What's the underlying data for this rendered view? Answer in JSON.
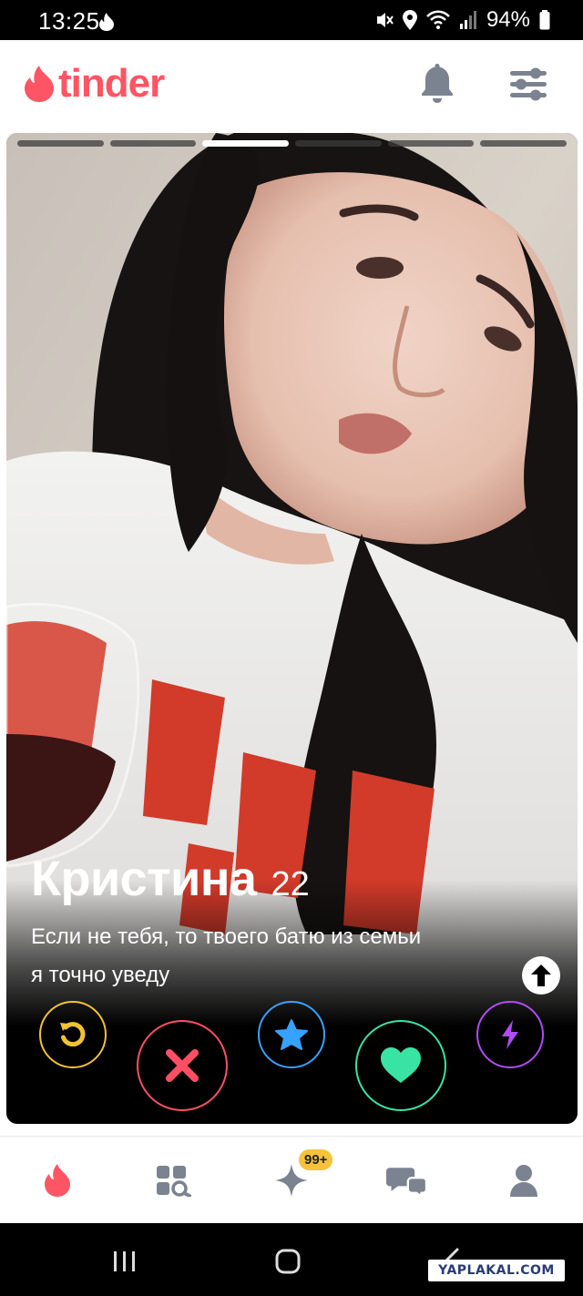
{
  "status_bar": {
    "time": "13:25",
    "battery": "94%"
  },
  "header": {
    "logo_text": "tinder",
    "brand_color": "#fd5564"
  },
  "card": {
    "photo_count": 6,
    "active_photo_index": 2,
    "name": "Кристина",
    "age": "22",
    "bio_line1": "Если не тебя, то твоего батю из семьи",
    "bio_line2": "я точно уведу"
  },
  "actions": {
    "icons": [
      "rewind-icon",
      "nope-icon",
      "super-like-icon",
      "like-icon",
      "boost-icon"
    ],
    "colors": {
      "rewind": "#f1c232",
      "nope": "#fd4f63",
      "super_like": "#37a1ff",
      "like": "#39e3a4",
      "boost": "#b14bf5"
    }
  },
  "bottom_nav": {
    "items": [
      "flame-icon",
      "explore-icon",
      "sparkle-icon",
      "chat-icon",
      "profile-icon"
    ],
    "badge": "99+"
  },
  "watermark": "YAPLAKAL.COM"
}
